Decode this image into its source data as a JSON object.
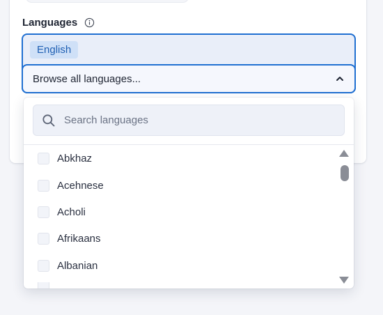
{
  "languages_field": {
    "label": "Languages",
    "selected": [
      "English"
    ],
    "browse_placeholder": "Browse all languages..."
  },
  "dropdown": {
    "search_placeholder": "Search languages",
    "items": [
      {
        "label": "Abkhaz",
        "checked": false
      },
      {
        "label": "Acehnese",
        "checked": false
      },
      {
        "label": "Acholi",
        "checked": false
      },
      {
        "label": "Afrikaans",
        "checked": false
      },
      {
        "label": "Albanian",
        "checked": false
      }
    ]
  },
  "icons": {
    "info": "info-icon",
    "chevron": "chevron-up-icon",
    "search": "search-icon",
    "scroll_up": "triangle-up-icon",
    "scroll_down": "triangle-down-icon"
  },
  "colors": {
    "accent": "#1f6fd1",
    "chip_bg": "#cfe0f7",
    "chip_text": "#1f5fb3"
  }
}
